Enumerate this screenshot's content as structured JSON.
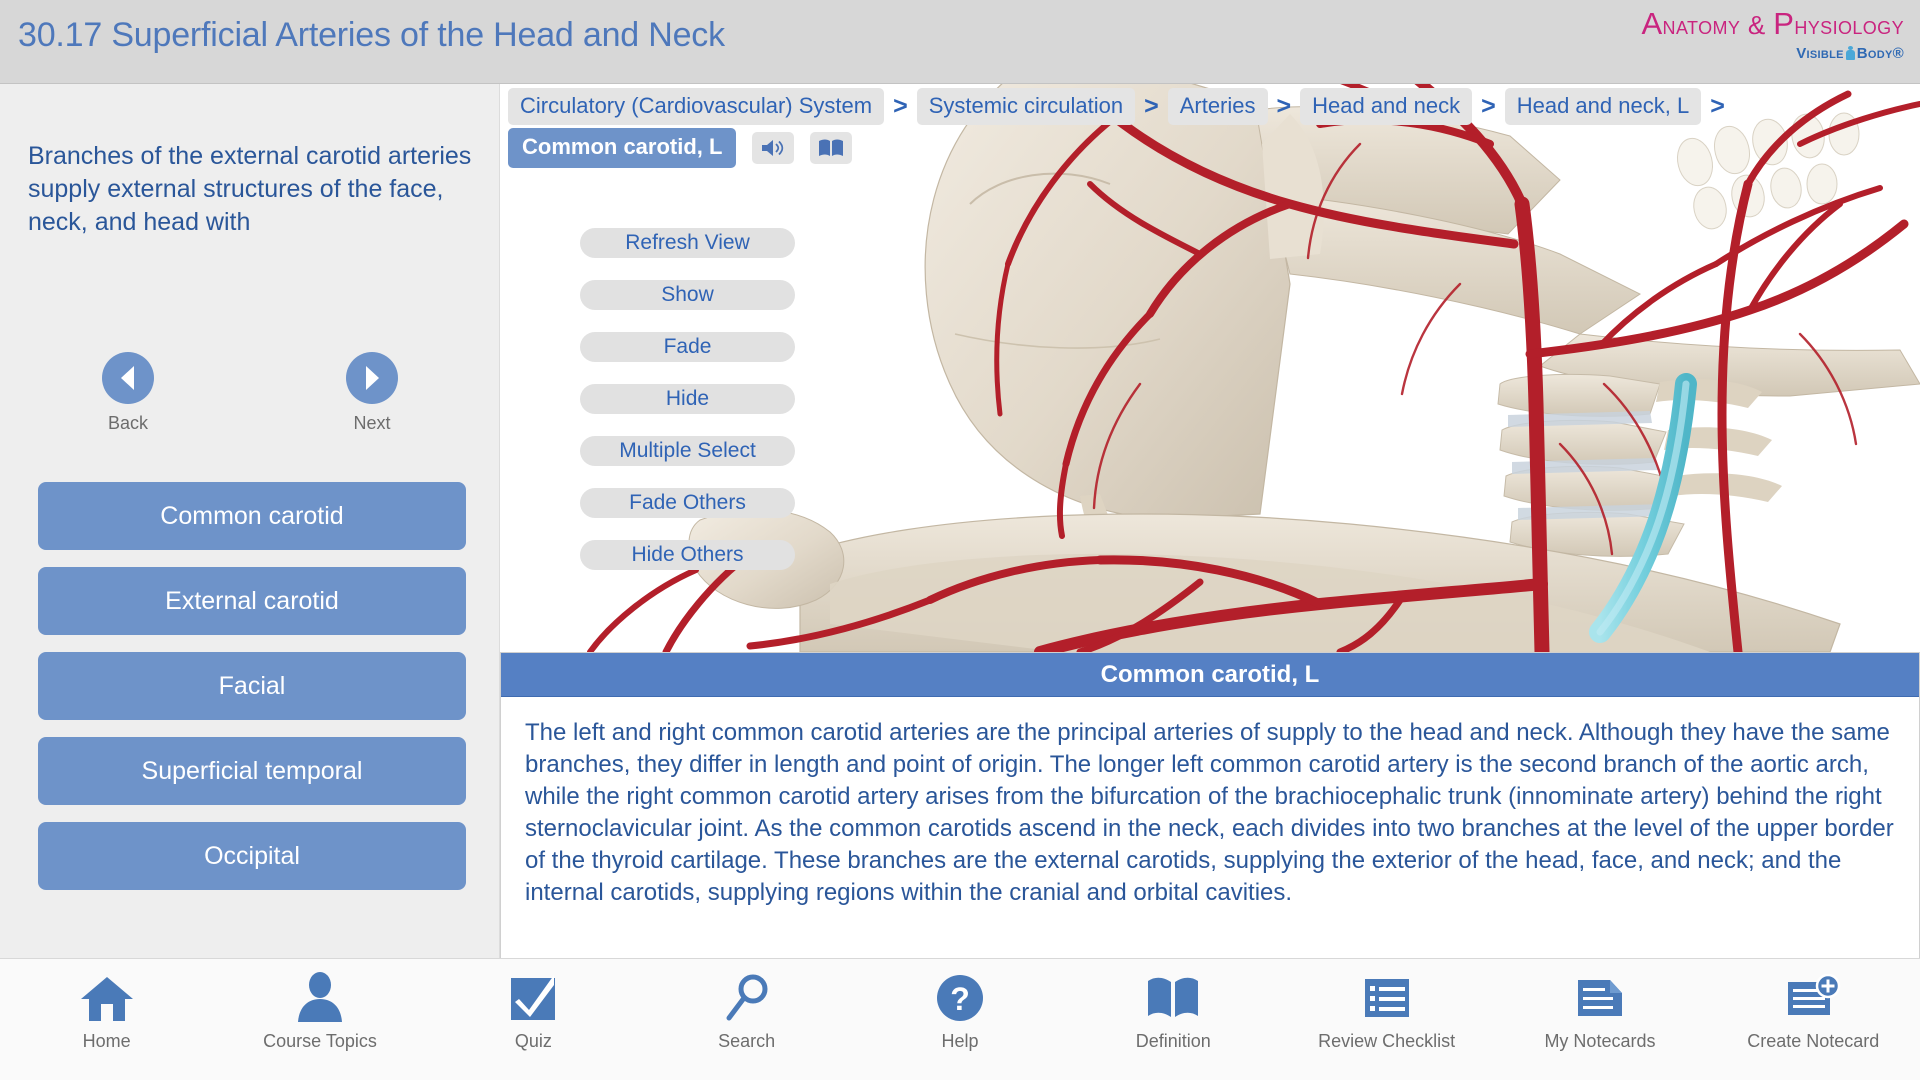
{
  "header": {
    "title": "30.17 Superficial Arteries of the Head and Neck",
    "brand_line1_a": "A",
    "brand_line1_b": "natomy & ",
    "brand_line1_c": "P",
    "brand_line1_d": "hysiology",
    "brand_full": "Anatomy & Physiology",
    "brand_sub_left": "Visible ",
    "brand_sub_right": "Body®"
  },
  "sidebar": {
    "description": "Branches of the external carotid arteries supply external structures of the face, neck, and head with",
    "back_label": "Back",
    "next_label": "Next",
    "structures": [
      {
        "label": "Common carotid"
      },
      {
        "label": "External carotid"
      },
      {
        "label": "Facial"
      },
      {
        "label": "Superficial temporal"
      },
      {
        "label": "Occipital"
      }
    ]
  },
  "breadcrumb": {
    "separator": ">",
    "items": [
      {
        "label": "Circulatory (Cardiovascular) System"
      },
      {
        "label": "Systemic circulation"
      },
      {
        "label": "Arteries"
      },
      {
        "label": "Head and neck"
      },
      {
        "label": "Head and neck, L"
      }
    ]
  },
  "selection": {
    "chip_label": "Common carotid, L",
    "audio_icon": "speaker-icon",
    "definition_icon": "book-icon"
  },
  "view_tools": [
    {
      "label": "Refresh View"
    },
    {
      "label": "Show"
    },
    {
      "label": "Fade"
    },
    {
      "label": "Hide"
    },
    {
      "label": "Multiple Select"
    },
    {
      "label": "Fade Others"
    },
    {
      "label": "Hide Others"
    }
  ],
  "info_panel": {
    "title": "Common carotid, L",
    "description": "The left and right common carotid arteries are the principal arteries of supply to the head and neck. Although they have the same branches, they differ in length and point of origin. The longer left common carotid artery is the second branch of the aortic arch, while the right common carotid artery arises from the bifurcation of the brachiocephalic trunk (innominate artery) behind the right sternoclavicular joint. As the common carotids ascend in the neck, each divides into two branches at the level of the upper border of the thyroid cartilage. These branches are the external carotids, supplying the exterior of the head, face, and neck; and the internal carotids, supplying regions within the cranial and orbital cavities."
  },
  "bottom_nav": [
    {
      "label": "Home",
      "icon": "home-icon"
    },
    {
      "label": "Course Topics",
      "icon": "person-icon"
    },
    {
      "label": "Quiz",
      "icon": "checkmark-icon"
    },
    {
      "label": "Search",
      "icon": "magnifier-icon"
    },
    {
      "label": "Help",
      "icon": "question-mark-icon"
    },
    {
      "label": "Definition",
      "icon": "open-book-icon"
    },
    {
      "label": "Review Checklist",
      "icon": "list-icon"
    },
    {
      "label": "My Notecards",
      "icon": "note-icon"
    },
    {
      "label": "Create Notecard",
      "icon": "note-plus-icon"
    }
  ],
  "model": {
    "alt": "3D anatomical model of skull, cervical spine and superficial arteries of head and neck",
    "artery_color": "#b31f2a",
    "bone_color": "#e3dace",
    "highlight_color": "#7fd4e0"
  },
  "colors": {
    "accent_blue": "#6e93c9",
    "text_blue": "#2a5699",
    "brand_pink": "#c9247f",
    "header_bg": "#d7d7d7"
  }
}
